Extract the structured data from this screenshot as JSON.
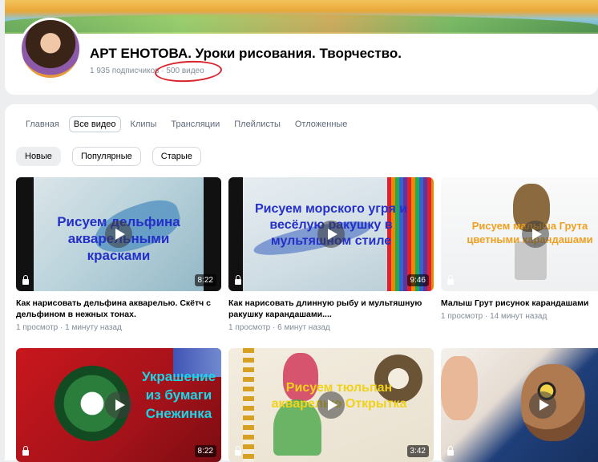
{
  "channel": {
    "name": "АРТ ЕНОТОВА. Уроки рисования. Творчество.",
    "subscribers": "1 935 подписчиков",
    "separator": "·",
    "videos_count": "500 видео"
  },
  "tabs": [
    {
      "label": "Главная",
      "active": false
    },
    {
      "label": "Все видео",
      "active": true
    },
    {
      "label": "Клипы",
      "active": false
    },
    {
      "label": "Трансляции",
      "active": false
    },
    {
      "label": "Плейлисты",
      "active": false
    },
    {
      "label": "Отложенные",
      "active": false
    }
  ],
  "filters": [
    {
      "label": "Новые",
      "active": true
    },
    {
      "label": "Популярные",
      "active": false
    },
    {
      "label": "Старые",
      "active": false
    }
  ],
  "videos": [
    {
      "thumb_text": "Рисуем дельфина акварельными красками",
      "duration": "8:22",
      "title": "Как нарисовать дельфина акварелью. Скётч с дельфином в нежных тонах.",
      "meta": "1 просмотр · 1 минуту назад"
    },
    {
      "thumb_text": "Рисуем морского угря и весёлую ракушку в мультяшном стиле",
      "duration": "9:46",
      "title": "Как нарисовать длинную рыбу и мультяшную ракушку карандашами....",
      "meta": "1 просмотр · 6 минут назад"
    },
    {
      "thumb_text": "Рисуем малыша Грута цветными карандашами",
      "duration": "",
      "title": "Малыш Грут рисунок карандашами",
      "meta": "1 просмотр · 14 минут назад"
    },
    {
      "thumb_text": "Украшение из бумаги Снежинка",
      "duration": "8:22",
      "title": "",
      "meta": ""
    },
    {
      "thumb_text": "Рисуем тюльпан акварелью Открытка",
      "duration": "3:42",
      "title": "",
      "meta": ""
    },
    {
      "thumb_text": "",
      "duration": "",
      "title": "",
      "meta": ""
    }
  ],
  "colors": {
    "accent_red": "#d9232b",
    "thumb_text_blue": "#2430c8",
    "thumb_text_cyan": "#19d6e8",
    "thumb_text_yellow": "#f0d21a",
    "thumb_text_red": "#e8282e"
  }
}
